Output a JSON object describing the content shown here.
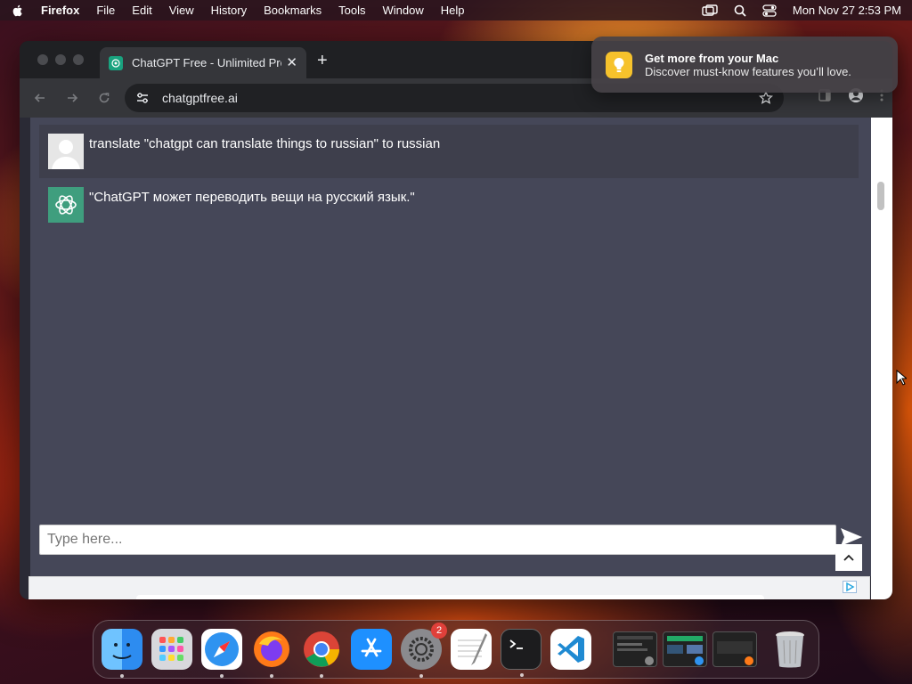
{
  "menubar": {
    "app_name": "Firefox",
    "menus": [
      "File",
      "Edit",
      "View",
      "History",
      "Bookmarks",
      "Tools",
      "Window",
      "Help"
    ],
    "clock": "Mon Nov 27  2:53 PM"
  },
  "browser": {
    "tab_title": "ChatGPT Free - Unlimited Pro",
    "url": "chatgptfree.ai"
  },
  "chat": {
    "user_message": "translate \"chatgpt can translate things to russian\" to russian",
    "bot_message": "\"ChatGPT может переводить вещи на русский язык.\"",
    "input_placeholder": "Type here..."
  },
  "notification": {
    "title": "Get more from your Mac",
    "body": "Discover must-know features you’ll love."
  },
  "dock": {
    "apps": [
      "Finder",
      "Launchpad",
      "Safari",
      "Firefox",
      "Chrome",
      "App Store",
      "System Settings",
      "TextEdit",
      "Terminal",
      "Visual Studio Code"
    ],
    "settings_badge": "2",
    "colors": {
      "finder": "#2d8cf0",
      "vscode": "#1f8ad2",
      "appstore": "#1e90ff"
    }
  }
}
